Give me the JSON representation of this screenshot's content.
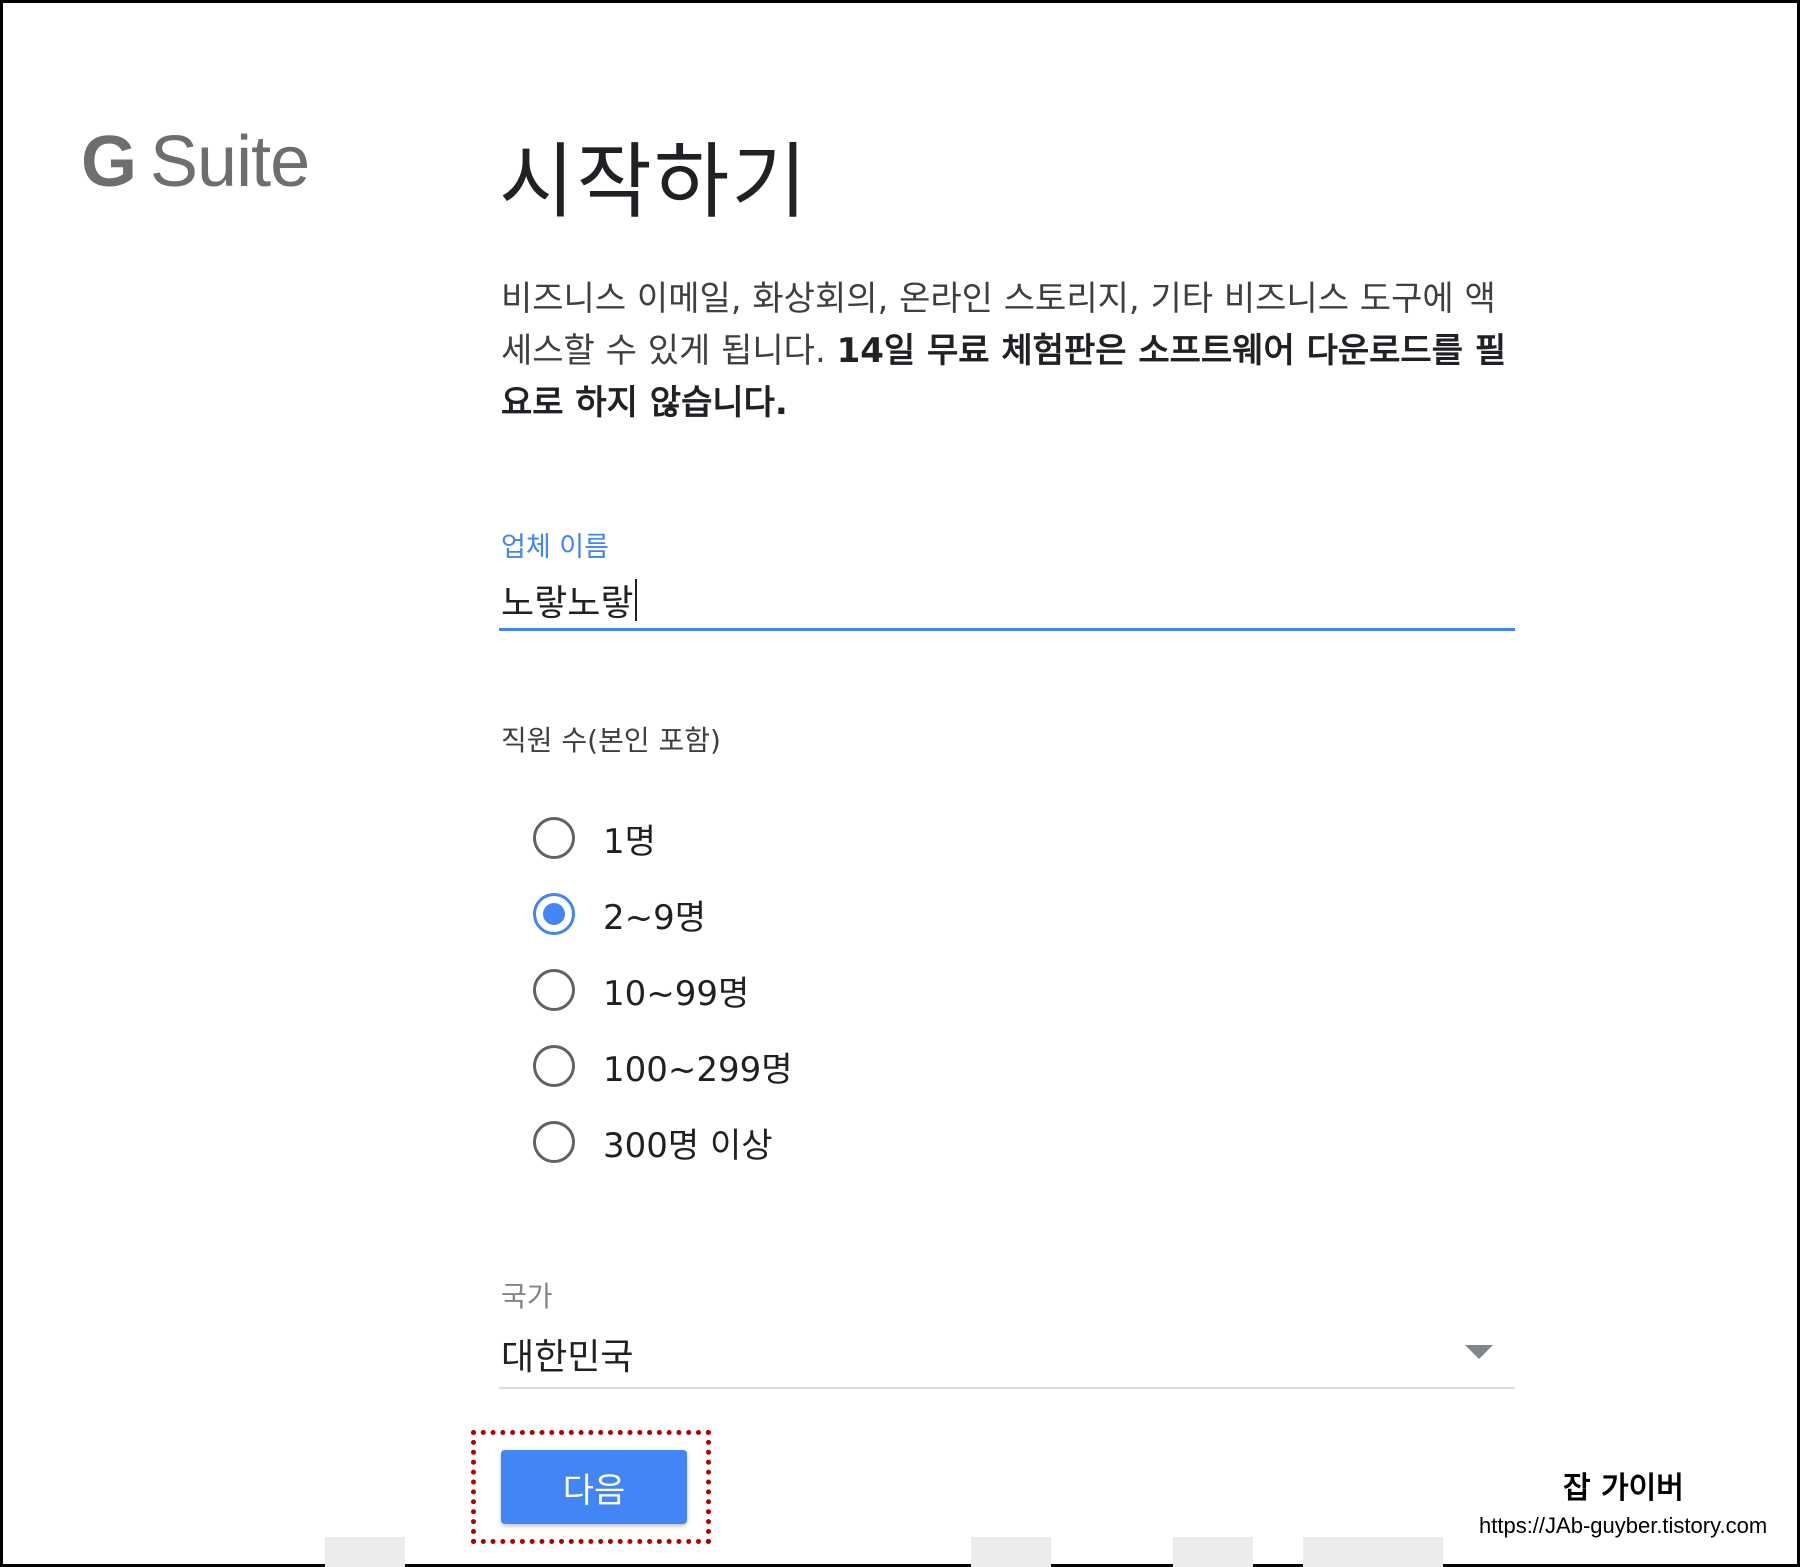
{
  "logo": {
    "text_g": "G",
    "text_suite": "Suite"
  },
  "page_title": "시작하기",
  "description": {
    "normal": "비즈니스 이메일, 화상회의, 온라인 스토리지, 기타 비즈니스 도구에 액세스할 수 있게 됩니다.",
    "bold": "14일 무료 체험판은 소프트웨어 다운로드를 필요로 하지 않습니다."
  },
  "company_name": {
    "label": "업체 이름",
    "value": "노랗노랗"
  },
  "employees": {
    "label": "직원 수(본인 포함)",
    "options": [
      {
        "label": "1명",
        "checked": false
      },
      {
        "label": "2~9명",
        "checked": true
      },
      {
        "label": "10~99명",
        "checked": false
      },
      {
        "label": "100~299명",
        "checked": false
      },
      {
        "label": "300명 이상",
        "checked": false
      }
    ]
  },
  "country": {
    "label": "국가",
    "value": "대한민국"
  },
  "next_button_label": "다음",
  "watermark": {
    "title": "잡 가이버",
    "url": "https://JAb-guyber.tistory.com"
  },
  "colors": {
    "accent": "#4285f4",
    "highlight_border": "#b00000"
  }
}
